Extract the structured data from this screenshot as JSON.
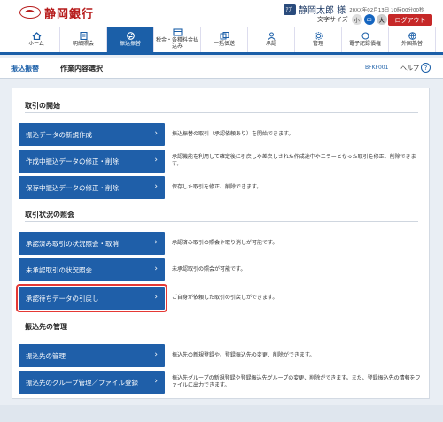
{
  "header": {
    "bank_name": "静岡銀行",
    "user_badge": "ｱﾌﾞ",
    "user_name": "静岡太郎 様",
    "login_time": "20XX年02月13日 10時00分00秒",
    "font_size_label": "文字サイズ",
    "font_sizes": [
      "小",
      "中",
      "大"
    ],
    "logout_label": "ログアウト"
  },
  "nav": {
    "items": [
      {
        "label": "ホーム",
        "icon": "home-icon"
      },
      {
        "label": "明細照会",
        "icon": "statement-icon"
      },
      {
        "label": "振込振替",
        "icon": "transfer-icon"
      },
      {
        "label": "税金・各種料金払込み",
        "icon": "tax-payment-icon"
      },
      {
        "label": "一括伝送",
        "icon": "bulk-transfer-icon"
      },
      {
        "label": "承認",
        "icon": "approval-icon"
      },
      {
        "label": "管理",
        "icon": "admin-icon"
      },
      {
        "label": "電子記録債権",
        "icon": "e-receivables-icon"
      },
      {
        "label": "外国為替",
        "icon": "forex-icon"
      }
    ],
    "active_index": 2
  },
  "crumb": {
    "section": "振込振替",
    "title": "作業内容選択",
    "screen_id": "BFKF001",
    "help_label": "ヘルプ"
  },
  "sections": [
    {
      "title": "取引の開始",
      "rows": [
        {
          "label": "振込データの新規作成",
          "desc": "振込振替の取引（承認依頼あり）を開始できます。"
        },
        {
          "label": "作成中振込データの修正・削除",
          "desc": "承認機能を利用して確定後に引戻しや差戻しされた作成途中やエラーとなった取引を修正、削除できます。"
        },
        {
          "label": "保存中振込データの修正・削除",
          "desc": "保存した取引を修正、削除できます。"
        }
      ]
    },
    {
      "title": "取引状況の照会",
      "rows": [
        {
          "label": "承認済み取引の状況照会・取消",
          "desc": "承認済み取引の照会や取り消しが可能です。"
        },
        {
          "label": "未承認取引の状況照会",
          "desc": "未承認取引の照会が可能です。"
        },
        {
          "label": "承認待ちデータの引戻し",
          "desc": "ご自身が依頼した取引の引戻しができます。"
        }
      ]
    },
    {
      "title": "振込先の管理",
      "rows": [
        {
          "label": "振込先の管理",
          "desc": "振込先の新規登録や、登録振込先の変更、削除ができます。"
        },
        {
          "label": "振込先のグループ管理／ファイル登録",
          "desc": "振込先グループの新規登録や登録振込先グループの変更、削除ができます。また、登録振込先の情報をファイルに出力できます。"
        }
      ]
    }
  ],
  "highlighted_row": "承認待ちデータの引戻し",
  "colors": {
    "accent": "#1f5fa9",
    "brand_red": "#b71c1c",
    "highlight": "#e53935"
  }
}
